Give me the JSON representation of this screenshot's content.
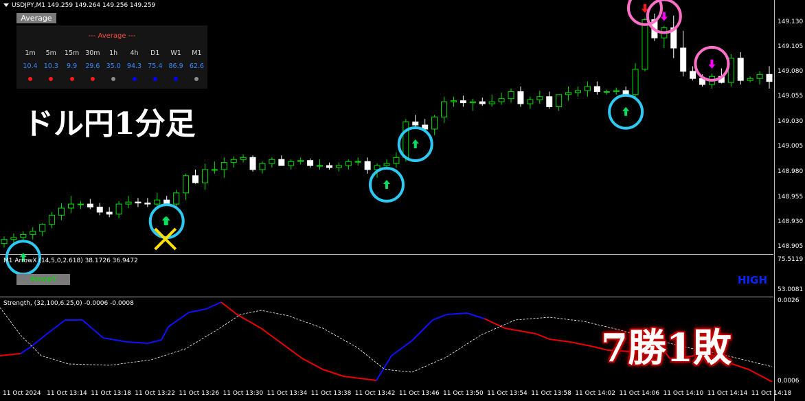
{
  "header": {
    "symbol_line": "USDJPY,M1  149.259 149.264 149.256 149.259"
  },
  "average_panel": {
    "button_label": "Average",
    "title": "--- Average ---",
    "timeframes": [
      "1m",
      "5m",
      "15m",
      "30m",
      "1h",
      "4h",
      "D1",
      "W1",
      "M1"
    ],
    "values": [
      "10.4",
      "10.3",
      "9.9",
      "29.6",
      "35.0",
      "94.3",
      "75.4",
      "86.9",
      "62.6"
    ],
    "dot_colors": [
      "#ff1a1a",
      "#ff1a1a",
      "#ff1a1a",
      "#ff1a1a",
      "#8c8c8c",
      "#0000ff",
      "#0000ff",
      "#0000ff",
      "#8c8c8c"
    ]
  },
  "overlay_text": {
    "chart_caption": "ドル円1分足",
    "result": "7勝1敗"
  },
  "indicator1": {
    "header": "M1  ArrowX (14,5,0,2.618) 38.1726 36.9472",
    "button_label": "ArrowY",
    "status": "HIGH",
    "scale_top": "75.5119",
    "scale_bottom": "53.0081"
  },
  "indicator2": {
    "header": "Strength, (32,100,6.25,0) -0.0006 -0.0008",
    "scale_top": "0.0026",
    "scale_bottom": "0.0006"
  },
  "price_scale": [
    "149.130",
    "149.105",
    "149.080",
    "149.055",
    "149.030",
    "149.005",
    "148.980",
    "148.955",
    "148.930",
    "148.905"
  ],
  "time_labels": [
    "11 Oct 2024",
    "11 Oct 13:14",
    "11 Oct 13:18",
    "11 Oct 13:22",
    "11 Oct 13:26",
    "11 Oct 13:30",
    "11 Oct 13:34",
    "11 Oct 13:38",
    "11 Oct 13:42",
    "11 Oct 13:46",
    "11 Oct 13:50",
    "11 Oct 13:54",
    "11 Oct 13:58",
    "11 Oct 14:02",
    "11 Oct 14:06",
    "11 Oct 14:10",
    "11 Oct 14:14",
    "11 Oct 14:18"
  ],
  "colors": {
    "bull_candle": "#00e000",
    "bear_candle": "#ffffff",
    "buy_ring": "#2ec9f2",
    "sell_ring": "#ff6ec7",
    "buy_arrow": "#00e060",
    "sell_arrow_red": "#ff1a1a",
    "sell_arrow_magenta": "#ff00ff",
    "strength_up": "#1010ff",
    "strength_down": "#ee0000",
    "cross": "#ffe000"
  },
  "icons": {
    "buy_signal": "up-arrow-icon",
    "sell_signal": "down-arrow-icon",
    "loss_marker": "x-cross-icon"
  },
  "chart_data": {
    "type": "candlestick",
    "symbol": "USDJPY",
    "timeframe": "M1",
    "ylim": [
      148.898,
      149.14
    ],
    "candles": [
      [
        148.905,
        148.912,
        148.901,
        148.909
      ],
      [
        148.909,
        148.915,
        148.904,
        148.911
      ],
      [
        148.911,
        148.917,
        148.906,
        148.914
      ],
      [
        148.914,
        148.921,
        148.909,
        148.917
      ],
      [
        148.917,
        148.925,
        148.912,
        148.924
      ],
      [
        148.924,
        148.936,
        148.92,
        148.933
      ],
      [
        148.933,
        148.945,
        148.928,
        148.94
      ],
      [
        148.94,
        148.952,
        148.935,
        148.944
      ],
      [
        148.944,
        148.947,
        148.939,
        148.944
      ],
      [
        148.944,
        148.949,
        148.939,
        148.941
      ],
      [
        148.941,
        148.945,
        148.933,
        148.936
      ],
      [
        148.936,
        148.941,
        148.931,
        148.934
      ],
      [
        148.934,
        148.947,
        148.93,
        148.944
      ],
      [
        148.944,
        148.952,
        148.94,
        148.946
      ],
      [
        148.946,
        148.95,
        148.941,
        148.945
      ],
      [
        148.945,
        148.95,
        148.941,
        148.944
      ],
      [
        148.944,
        148.955,
        148.939,
        148.948
      ],
      [
        148.948,
        148.952,
        148.942,
        148.944
      ],
      [
        148.944,
        148.958,
        148.94,
        148.955
      ],
      [
        148.955,
        148.974,
        148.948,
        148.972
      ],
      [
        148.972,
        148.978,
        148.964,
        148.965
      ],
      [
        148.965,
        148.984,
        148.958,
        148.978
      ],
      [
        148.978,
        148.986,
        148.974,
        148.978
      ],
      [
        148.978,
        148.99,
        148.97,
        148.985
      ],
      [
        148.985,
        148.991,
        148.98,
        148.988
      ],
      [
        148.988,
        148.993,
        148.985,
        148.99
      ],
      [
        148.99,
        148.992,
        148.976,
        148.978
      ],
      [
        148.978,
        148.986,
        148.974,
        148.984
      ],
      [
        148.984,
        148.99,
        148.98,
        148.988
      ],
      [
        148.988,
        148.992,
        148.982,
        148.982
      ],
      [
        148.982,
        148.988,
        148.978,
        148.986
      ],
      [
        148.986,
        148.99,
        148.983,
        148.987
      ],
      [
        148.987,
        148.989,
        148.98,
        148.982
      ],
      [
        148.982,
        148.988,
        148.978,
        148.982
      ],
      [
        148.982,
        148.985,
        148.978,
        148.98
      ],
      [
        148.98,
        148.985,
        148.976,
        148.982
      ],
      [
        148.982,
        148.988,
        148.978,
        148.986
      ],
      [
        148.986,
        148.99,
        148.982,
        148.986
      ],
      [
        148.986,
        148.99,
        148.974,
        148.978
      ],
      [
        148.978,
        148.984,
        148.97,
        148.982
      ],
      [
        148.982,
        148.988,
        148.978,
        148.984
      ],
      [
        148.984,
        148.995,
        148.98,
        148.99
      ],
      [
        148.99,
        149.028,
        148.986,
        149.025
      ],
      [
        149.025,
        149.032,
        149.018,
        149.022
      ],
      [
        149.022,
        149.028,
        149.015,
        149.018
      ],
      [
        149.018,
        149.032,
        149.012,
        149.03
      ],
      [
        149.03,
        149.05,
        149.024,
        149.045
      ],
      [
        149.045,
        149.05,
        149.04,
        149.046
      ],
      [
        149.046,
        149.051,
        149.04,
        149.044
      ],
      [
        149.044,
        149.048,
        149.036,
        149.045
      ],
      [
        149.045,
        149.049,
        149.041,
        149.043
      ],
      [
        149.043,
        149.052,
        149.04,
        149.045
      ],
      [
        149.045,
        149.054,
        149.042,
        149.048
      ],
      [
        149.048,
        149.058,
        149.044,
        149.055
      ],
      [
        149.055,
        149.06,
        149.04,
        149.043
      ],
      [
        149.043,
        149.05,
        149.038,
        149.047
      ],
      [
        149.047,
        149.056,
        149.043,
        149.05
      ],
      [
        149.05,
        149.055,
        149.038,
        149.04
      ],
      [
        149.04,
        149.05,
        149.036,
        149.052
      ],
      [
        149.052,
        149.06,
        149.046,
        149.054
      ],
      [
        149.054,
        149.06,
        149.05,
        149.056
      ],
      [
        149.056,
        149.065,
        149.05,
        149.06
      ],
      [
        149.06,
        149.065,
        149.052,
        149.055
      ],
      [
        149.055,
        149.057,
        149.052,
        149.055
      ],
      [
        149.055,
        149.059,
        149.052,
        149.056
      ],
      [
        149.056,
        149.06,
        149.05,
        149.052
      ],
      [
        149.052,
        149.083,
        149.048,
        149.077
      ],
      [
        149.077,
        149.128,
        149.075,
        149.126
      ],
      [
        149.126,
        149.132,
        149.105,
        149.108
      ],
      [
        149.108,
        149.12,
        149.098,
        149.118
      ],
      [
        149.118,
        149.13,
        149.088,
        149.098
      ],
      [
        149.098,
        149.115,
        149.07,
        149.075
      ],
      [
        149.075,
        149.08,
        149.066,
        149.068
      ],
      [
        149.068,
        149.072,
        149.06,
        149.062
      ],
      [
        149.062,
        149.073,
        149.058,
        149.07
      ],
      [
        149.07,
        149.078,
        149.063,
        149.064
      ],
      [
        149.064,
        149.092,
        149.06,
        149.088
      ],
      [
        149.088,
        149.094,
        149.062,
        149.066
      ],
      [
        149.066,
        149.07,
        149.064,
        149.068
      ],
      [
        149.068,
        149.075,
        149.062,
        149.072
      ],
      [
        149.072,
        149.08,
        149.058,
        149.065
      ]
    ],
    "buy_signals_candle_index": [
      2,
      17,
      40,
      43,
      65
    ],
    "sell_signals_candle_index": [
      67,
      69,
      74
    ],
    "loss_marker_candle_index": 17
  }
}
